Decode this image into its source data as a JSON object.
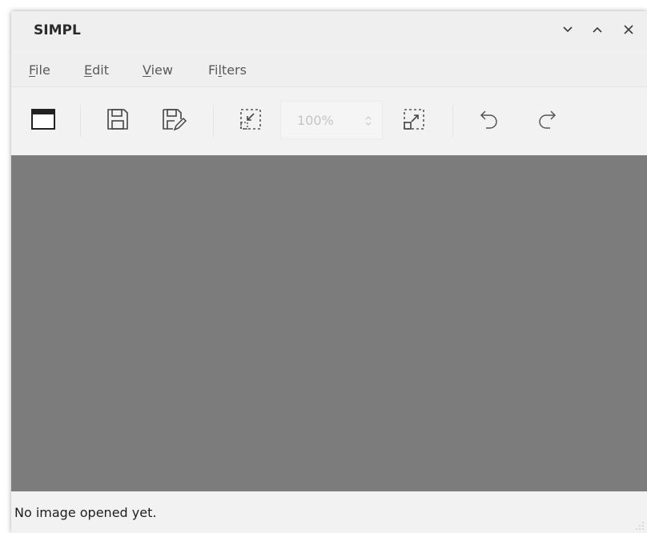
{
  "window": {
    "title": "SIMPL",
    "controls": [
      {
        "name": "minimize-button",
        "icon": "chevron-down-icon"
      },
      {
        "name": "maximize-button",
        "icon": "chevron-up-icon"
      },
      {
        "name": "close-button",
        "icon": "close-icon"
      }
    ]
  },
  "menubar": {
    "items": [
      {
        "label_first": "F",
        "label_rest": "ile",
        "label": "File"
      },
      {
        "label_first": "E",
        "label_rest": "dit",
        "label": "Edit"
      },
      {
        "label_first": "V",
        "label_rest": "iew",
        "label": "View"
      },
      {
        "label_first": "Fi",
        "label_mid": "l",
        "label_rest": "ters",
        "label": "Filters"
      }
    ]
  },
  "toolbar": {
    "buttons": [
      {
        "icon": "open-folder-icon"
      },
      {
        "icon": "save-icon"
      },
      {
        "icon": "save-as-icon"
      },
      {
        "icon": "zoom-fit-icon"
      },
      {
        "icon": "zoom-expand-icon"
      },
      {
        "icon": "undo-icon"
      },
      {
        "icon": "redo-icon"
      }
    ],
    "zoom_value": "100%"
  },
  "canvas": {
    "background": "#7c7c7c"
  },
  "statusbar": {
    "message": "No image opened yet."
  }
}
